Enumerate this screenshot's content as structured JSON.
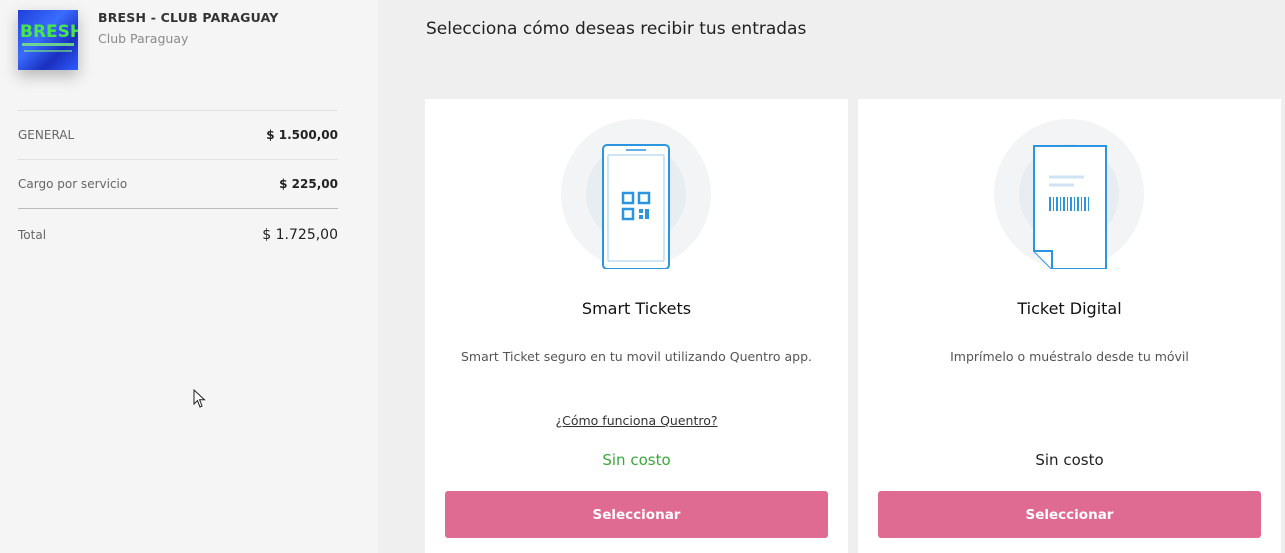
{
  "event": {
    "title": "BRESH - CLUB PARAGUAY",
    "venue": "Club Paraguay",
    "image_label": "BRESH"
  },
  "summary": {
    "rows": [
      {
        "label": "GENERAL",
        "value": "$ 1.500,00"
      },
      {
        "label": "Cargo por servicio",
        "value": "$ 225,00"
      }
    ],
    "total": {
      "label": "Total",
      "value": "$ 1.725,00"
    }
  },
  "main": {
    "heading": "Selecciona cómo deseas recibir tus entradas"
  },
  "options": [
    {
      "title": "Smart Tickets",
      "description": "Smart Ticket seguro en tu movil utilizando Quentro app.",
      "link": "¿Cómo funciona Quentro?",
      "cost": "Sin costo",
      "button": "Seleccionar",
      "icon": "phone-qr-icon"
    },
    {
      "title": "Ticket Digital",
      "description": "Imprímelo o muéstralo desde tu móvil",
      "cost": "Sin costo",
      "button": "Seleccionar",
      "icon": "ticket-barcode-icon"
    }
  ],
  "colors": {
    "accent_button": "#e06b92",
    "free_green": "#3aa83a",
    "icon_blue": "#2b95e0"
  }
}
